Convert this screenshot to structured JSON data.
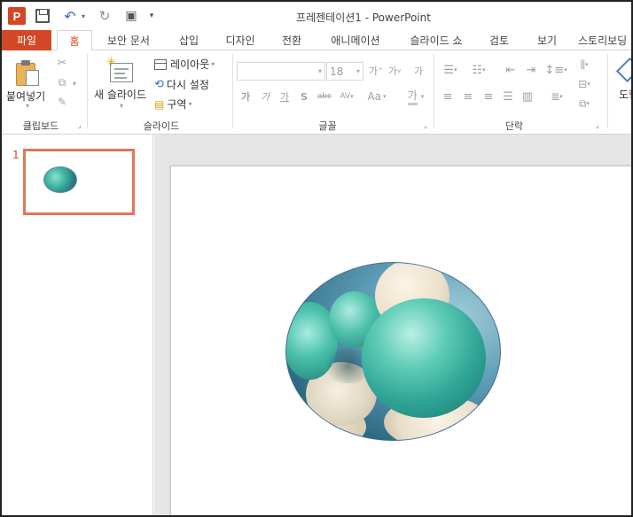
{
  "window": {
    "title": "프레젠테이션1 - PowerPoint",
    "app_icon_letter": "P",
    "accent_color": "#d24726"
  },
  "tabs": {
    "file": "파일",
    "items": [
      "홈",
      "보안 문서",
      "삽입",
      "디자인",
      "전환",
      "애니메이션",
      "슬라이드 쇼",
      "검토",
      "보기",
      "스토리보딩"
    ],
    "active": "홈"
  },
  "ribbon": {
    "clipboard": {
      "paste_label": "붙여넣기",
      "group_label": "클립보드"
    },
    "slides": {
      "new_slide_label": "새 슬라이드",
      "layout_label": "레이아웃",
      "reset_label": "다시 설정",
      "section_label": "구역",
      "group_label": "슬라이드"
    },
    "font": {
      "font_name_value": "",
      "font_size_value": "18",
      "group_label": "글꼴",
      "grow_icon_label": "가",
      "shrink_icon_label": "가",
      "clear_format_label": "가",
      "bold_label": "가",
      "italic_label": "가",
      "underline_label": "가",
      "shadow_label": "S",
      "strike_label": "abc",
      "spacing_label": "AV",
      "case_label": "Aa",
      "color_label": "가"
    },
    "paragraph": {
      "group_label": "단락"
    },
    "drawing": {
      "partial_label": "도형"
    }
  },
  "thumbnails": {
    "slide_number": "1"
  }
}
